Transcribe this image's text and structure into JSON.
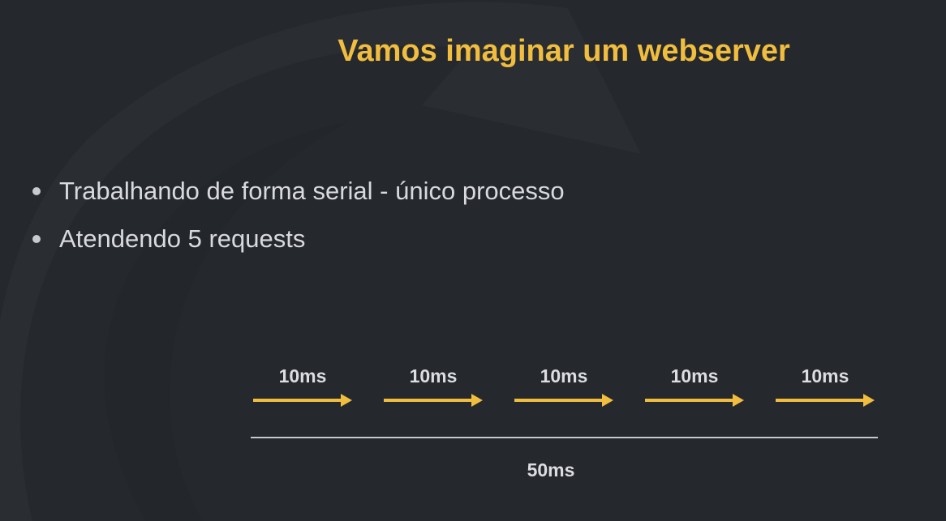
{
  "slide": {
    "title": "Vamos imaginar um webserver",
    "bullets": [
      "Trabalhando de forma serial - único processo",
      "Atendendo 5 requests"
    ]
  },
  "diagram": {
    "segments": [
      {
        "label": "10ms"
      },
      {
        "label": "10ms"
      },
      {
        "label": "10ms"
      },
      {
        "label": "10ms"
      },
      {
        "label": "10ms"
      }
    ],
    "total_label": "50ms"
  },
  "colors": {
    "background": "#25282d",
    "accent": "#f0bd3f",
    "text": "#d9dade",
    "timeline": "#c8c9cd"
  }
}
